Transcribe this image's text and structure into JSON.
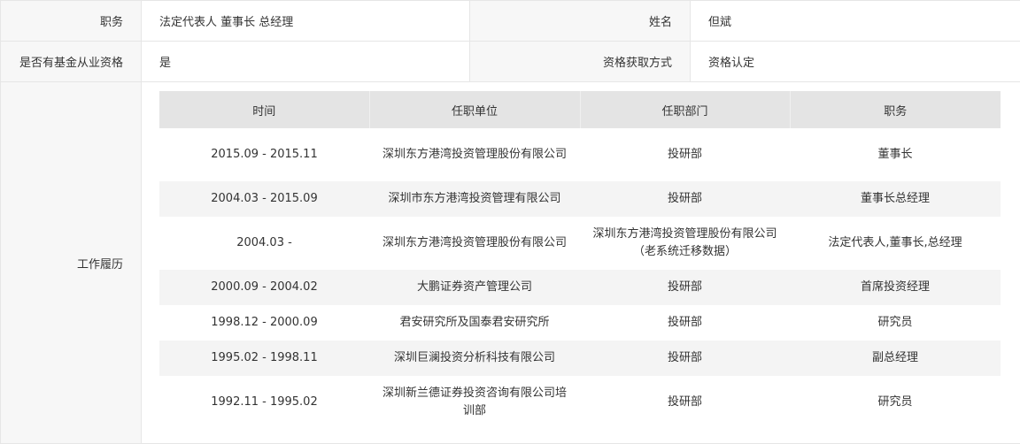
{
  "fields": {
    "position_label": "职务",
    "position_value": "法定代表人 董事长 总经理",
    "name_label": "姓名",
    "name_value": "但斌",
    "qualification_label": "是否有基金从业资格",
    "qualification_value": "是",
    "qualification_method_label": "资格获取方式",
    "qualification_method_value": "资格认定",
    "work_history_label": "工作履历"
  },
  "resume": {
    "headers": [
      "时间",
      "任职单位",
      "任职部门",
      "职务"
    ],
    "rows": [
      {
        "time": "2015.09 - 2015.11",
        "company": "深圳东方港湾投资管理股份有限公司",
        "department": "投研部",
        "title": "董事长"
      },
      {
        "time": "2004.03 - 2015.09",
        "company": "深圳市东方港湾投资管理有限公司",
        "department": "投研部",
        "title": "董事长总经理"
      },
      {
        "time": "2004.03 -",
        "company": "深圳东方港湾投资管理股份有限公司",
        "department": "深圳东方港湾投资管理股份有限公司（老系统迁移数据）",
        "title": "法定代表人,董事长,总经理"
      },
      {
        "time": "2000.09 - 2004.02",
        "company": "大鹏证券资产管理公司",
        "department": "投研部",
        "title": "首席投资经理"
      },
      {
        "time": "1998.12 - 2000.09",
        "company": "君安研究所及国泰君安研究所",
        "department": "投研部",
        "title": "研究员"
      },
      {
        "time": "1995.02 - 1998.11",
        "company": "深圳巨澜投资分析科技有限公司",
        "department": "投研部",
        "title": "副总经理"
      },
      {
        "time": "1992.11 - 1995.02",
        "company": "深圳新兰德证券投资咨询有限公司培训部",
        "department": "投研部",
        "title": "研究员"
      }
    ]
  }
}
